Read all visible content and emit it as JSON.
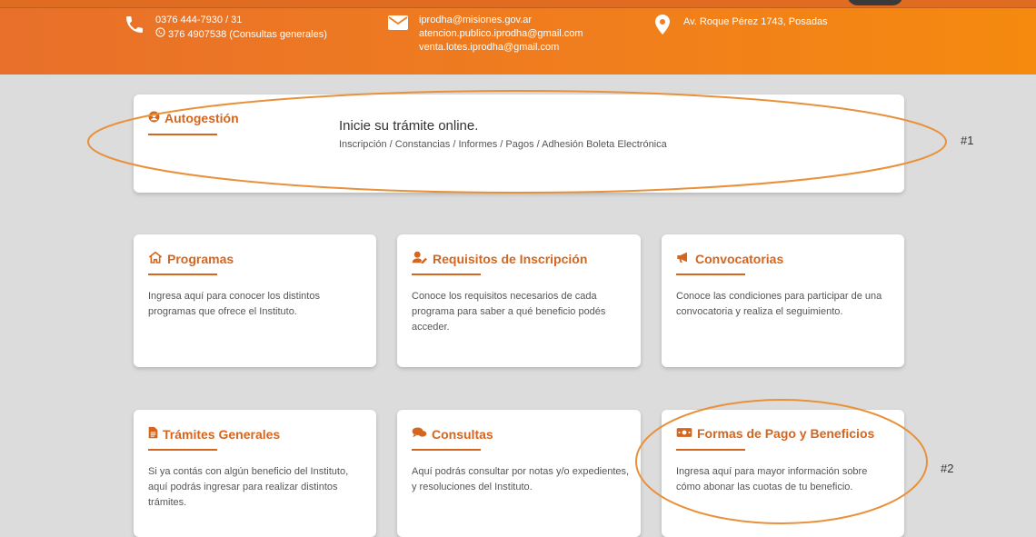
{
  "header": {
    "phone_1": "0376 444-7930 / 31",
    "phone_2": "376 4907538 (Consultas generales)",
    "email_1": "iprodha@misiones.gov.ar",
    "email_2": "atencion.publico.iprodha@gmail.com",
    "email_3": "venta.lotes.iprodha@gmail.com",
    "address": "Av. Roque Pérez 1743, Posadas"
  },
  "autogestion": {
    "title": "Autogestión",
    "subtitle": "Inicie su trámite online.",
    "description": "Inscripción / Constancias / Informes / Pagos / Adhesión Boleta Electrónica"
  },
  "cards": [
    {
      "title": "Programas",
      "description": "Ingresa aquí para conocer los distintos programas que ofrece el Instituto."
    },
    {
      "title": "Requisitos de Inscripción",
      "description": "Conoce los requisitos necesarios de cada programa para saber a qué beneficio podés acceder."
    },
    {
      "title": "Convocatorias",
      "description": "Conoce las condiciones para participar de una convocatoria y realiza el seguimiento."
    },
    {
      "title": "Trámites Generales",
      "description": "Si ya contás con algún beneficio del Instituto, aquí podrás ingresar para realizar distintos trámites."
    },
    {
      "title": "Consultas",
      "description": "Aquí podrás consultar por notas y/o expedientes, y resoluciones del Instituto."
    },
    {
      "title": "Formas de Pago y Beneficios",
      "description": "Ingresa aquí para mayor información sobre cómo abonar las cuotas de tu beneficio."
    }
  ],
  "annotations": {
    "label_1": "#1",
    "label_2": "#2"
  },
  "icons": {
    "phone": "phone-icon",
    "whatsapp": "whatsapp-icon",
    "email": "envelope-icon",
    "address": "map-pin-icon",
    "autogestion": "user-circle-icon",
    "programas": "house-icon",
    "requisitos": "user-edit-icon",
    "convocatorias": "megaphone-icon",
    "tramites": "file-icon",
    "consultas": "comments-icon",
    "pagos": "money-bill-icon"
  },
  "colors": {
    "header": "#f07d1e",
    "accent": "#d4661f",
    "annotation": "#e8913a",
    "background": "#dcdcdc"
  }
}
